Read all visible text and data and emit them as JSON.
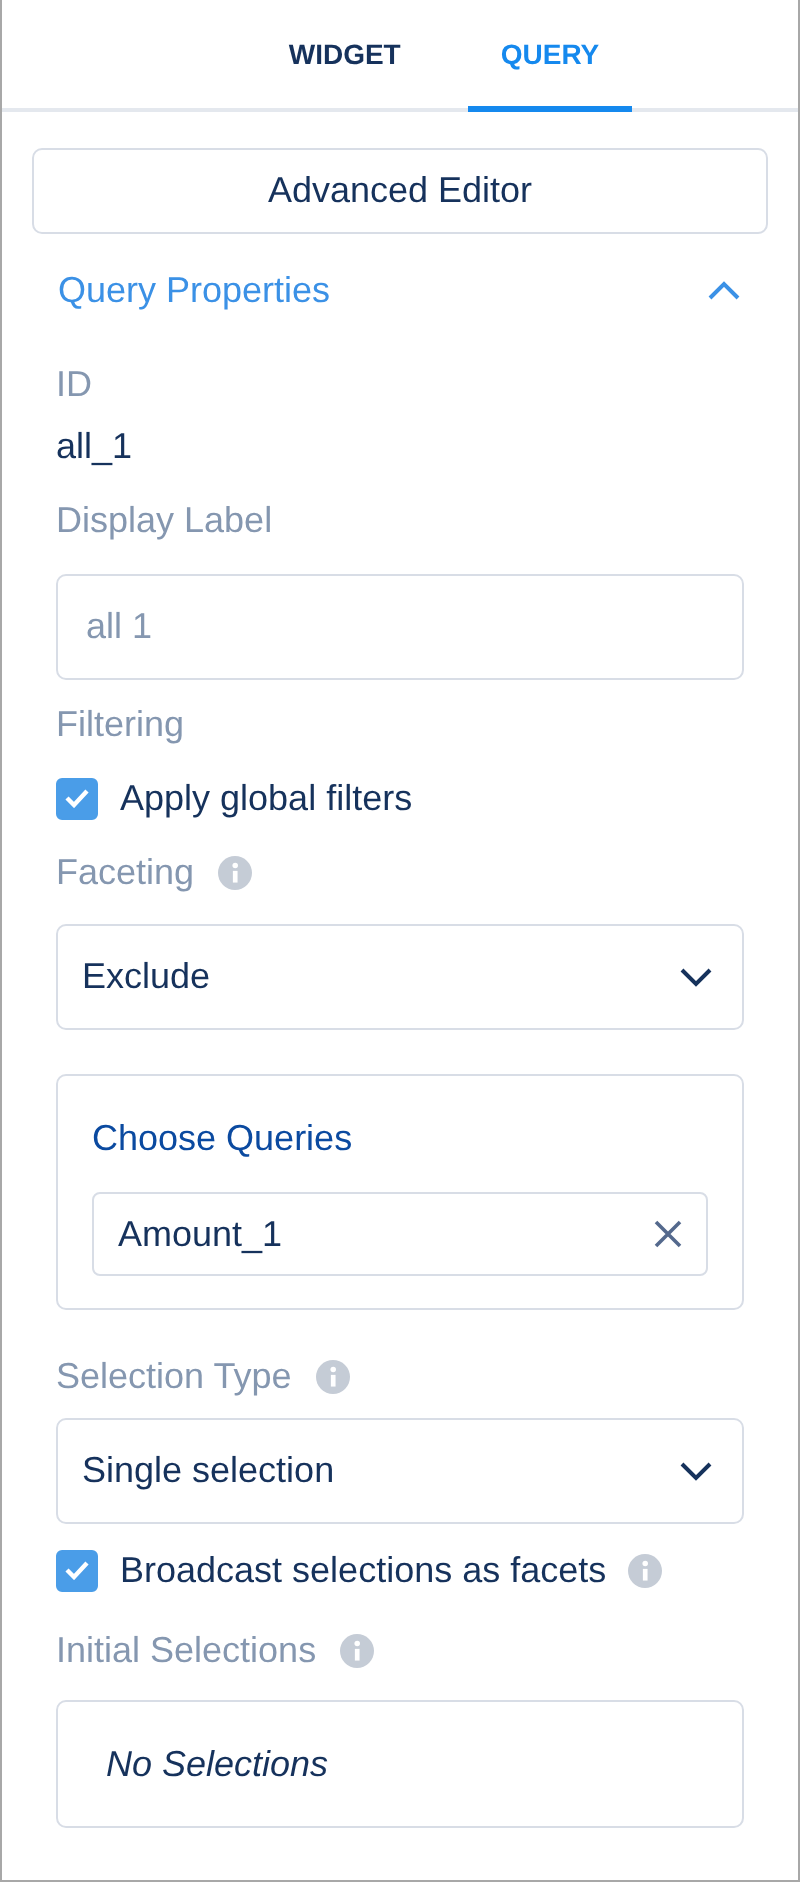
{
  "tabs": [
    {
      "label": "WIDGET",
      "selected": false
    },
    {
      "label": "QUERY",
      "selected": true
    }
  ],
  "advanced_editor_button": "Advanced Editor",
  "section": {
    "title": "Query Properties",
    "expanded": true
  },
  "id": {
    "label": "ID",
    "value": "all_1"
  },
  "display_label": {
    "label": "Display Label",
    "placeholder": "all 1"
  },
  "filtering": {
    "label": "Filtering",
    "checkbox": {
      "label": "Apply global filters",
      "checked": true
    }
  },
  "faceting": {
    "label": "Faceting",
    "info": true,
    "value": "Exclude"
  },
  "choose_queries": {
    "title": "Choose Queries",
    "pills": [
      "Amount_1"
    ]
  },
  "selection_type": {
    "label": "Selection Type",
    "info": true,
    "value": "Single selection"
  },
  "broadcast": {
    "label": "Broadcast selections as facets",
    "checked": true,
    "info": true
  },
  "initial_selections": {
    "label": "Initial Selections",
    "info": true,
    "value": "No Selections"
  }
}
